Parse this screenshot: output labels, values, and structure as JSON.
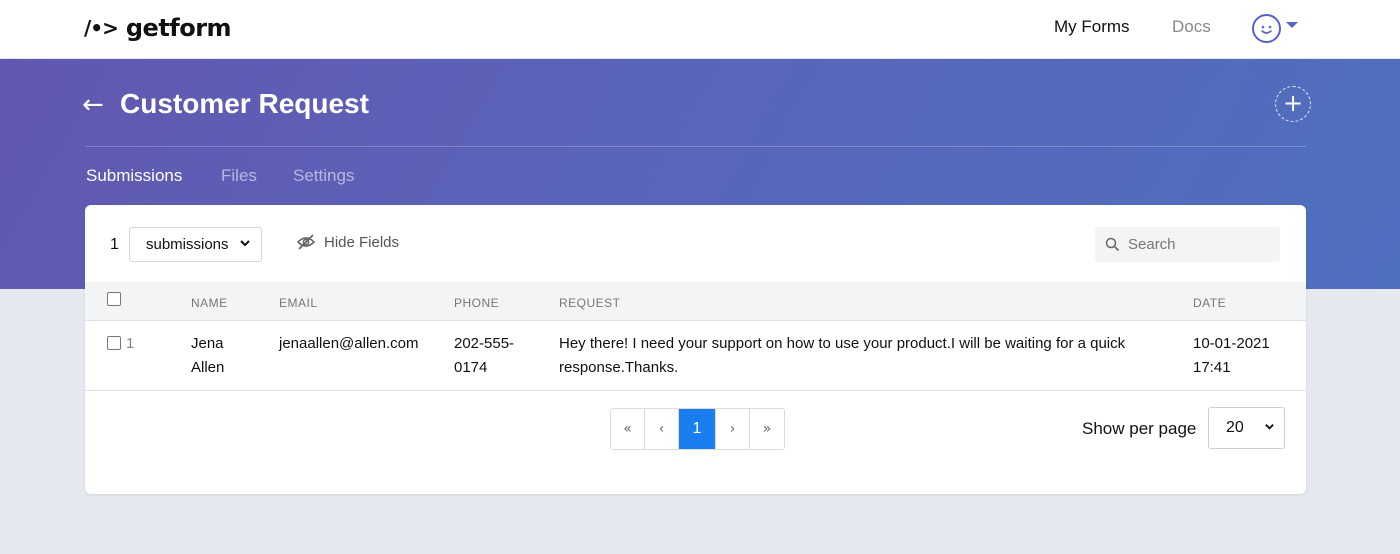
{
  "app": {
    "logo_mark": "/•>",
    "logo_text": "getform"
  },
  "nav": {
    "my_forms": "My Forms",
    "docs": "Docs"
  },
  "colors": {
    "accent": "#5a62c8",
    "hero_start": "#6157b0",
    "hero_end": "#4f6fbf",
    "pager_active": "#1a7df0"
  },
  "header": {
    "back_icon": "←",
    "title": "Customer Request",
    "add_icon": "+"
  },
  "tabs": [
    {
      "label": "Submissions",
      "active": true
    },
    {
      "label": "Files",
      "active": false
    },
    {
      "label": "Settings",
      "active": false
    }
  ],
  "toolbar": {
    "count": "1",
    "filter_value": "submissions",
    "hide_fields_label": "Hide Fields",
    "search_placeholder": "Search"
  },
  "table": {
    "columns": [
      "NAME",
      "EMAIL",
      "PHONE",
      "REQUEST",
      "DATE"
    ],
    "rows": [
      {
        "index": "1",
        "name_first": "Jena",
        "name_last": "Allen",
        "email": "jenaallen@allen.com",
        "phone_line1": "202-555-",
        "phone_line2": "0174",
        "request_line1": "Hey there! I need your support on how to use your product.I will be waiting for a quick",
        "request_line2": "response.Thanks.",
        "date_line1": "10-01-2021",
        "date_line2": "17:41"
      }
    ]
  },
  "pagination": {
    "first": "«",
    "prev": "‹",
    "current": "1",
    "next": "›",
    "last": "»"
  },
  "per_page": {
    "label": "Show per page",
    "value": "20"
  }
}
